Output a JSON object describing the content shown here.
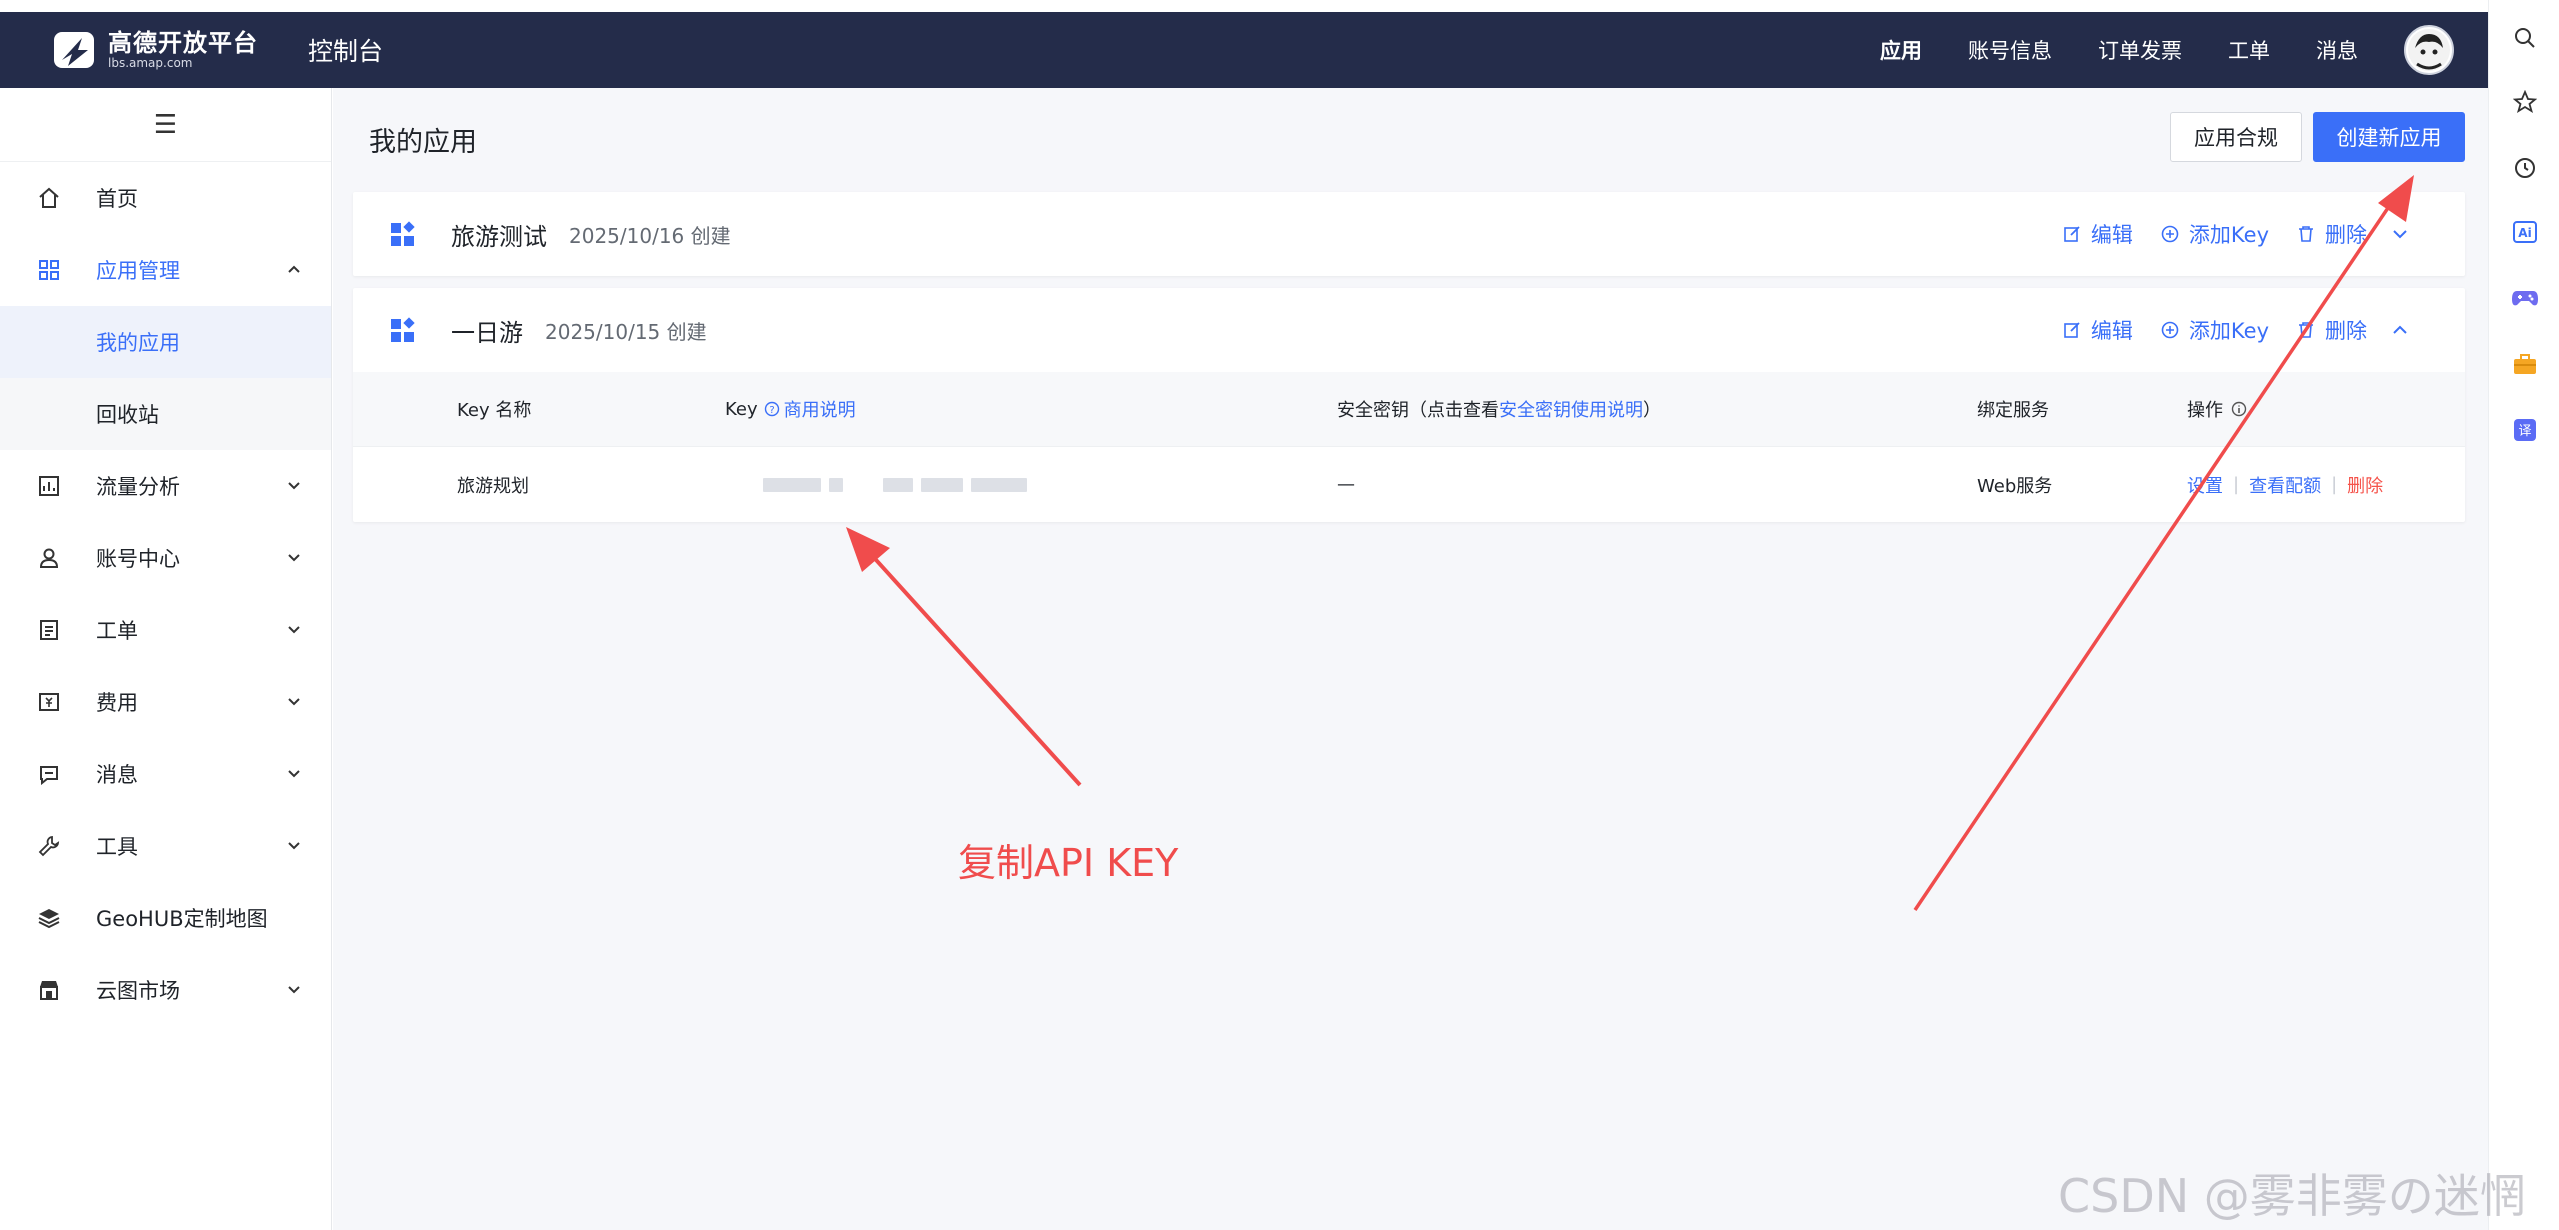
{
  "brand": {
    "title": "高德开放平台",
    "subtitle": "lbs.amap.com"
  },
  "console_title": "控制台",
  "topnav": [
    "应用",
    "账号信息",
    "订单发票",
    "工单",
    "消息"
  ],
  "sidebar": {
    "items": [
      {
        "label": "首页",
        "icon": "home-icon"
      },
      {
        "label": "应用管理",
        "icon": "grid-icon",
        "expanded": true
      },
      {
        "label": "流量分析",
        "icon": "chart-icon"
      },
      {
        "label": "账号中心",
        "icon": "user-icon"
      },
      {
        "label": "工单",
        "icon": "ticket-icon"
      },
      {
        "label": "费用",
        "icon": "money-icon"
      },
      {
        "label": "消息",
        "icon": "message-icon"
      },
      {
        "label": "工具",
        "icon": "wrench-icon"
      },
      {
        "label": "GeoHUB定制地图",
        "icon": "layers-icon"
      },
      {
        "label": "云图市场",
        "icon": "store-icon"
      }
    ],
    "sub_items": [
      "我的应用",
      "回收站"
    ]
  },
  "main": {
    "title": "我的应用",
    "compliance_button": "应用合规",
    "create_button": "创建新应用",
    "apps": [
      {
        "name": "旅游测试",
        "date": "2025/10/16 创建"
      },
      {
        "name": "一日游",
        "date": "2025/10/15 创建"
      }
    ],
    "actions": {
      "edit": "编辑",
      "add_key": "添加Key",
      "delete": "删除"
    },
    "table": {
      "headers": {
        "name": "Key 名称",
        "key": "Key",
        "key_link": "商用说明",
        "secret_prefix": "安全密钥（点击查看",
        "secret_link": "安全密钥使用说明",
        "secret_suffix": "）",
        "service": "绑定服务",
        "ops": "操作"
      },
      "rows": [
        {
          "name": "旅游规划",
          "secret": "—",
          "service": "Web服务",
          "op_settings": "设置",
          "op_quota": "查看配额",
          "op_delete": "删除"
        }
      ]
    }
  },
  "annotation": "复制API KEY",
  "watermark": "CSDN @雾非雾の迷惘",
  "colors": {
    "nav_bg": "#242c4a",
    "accent": "#3a6ff8",
    "danger": "#f5524a",
    "annotation": "#f04c4c"
  }
}
